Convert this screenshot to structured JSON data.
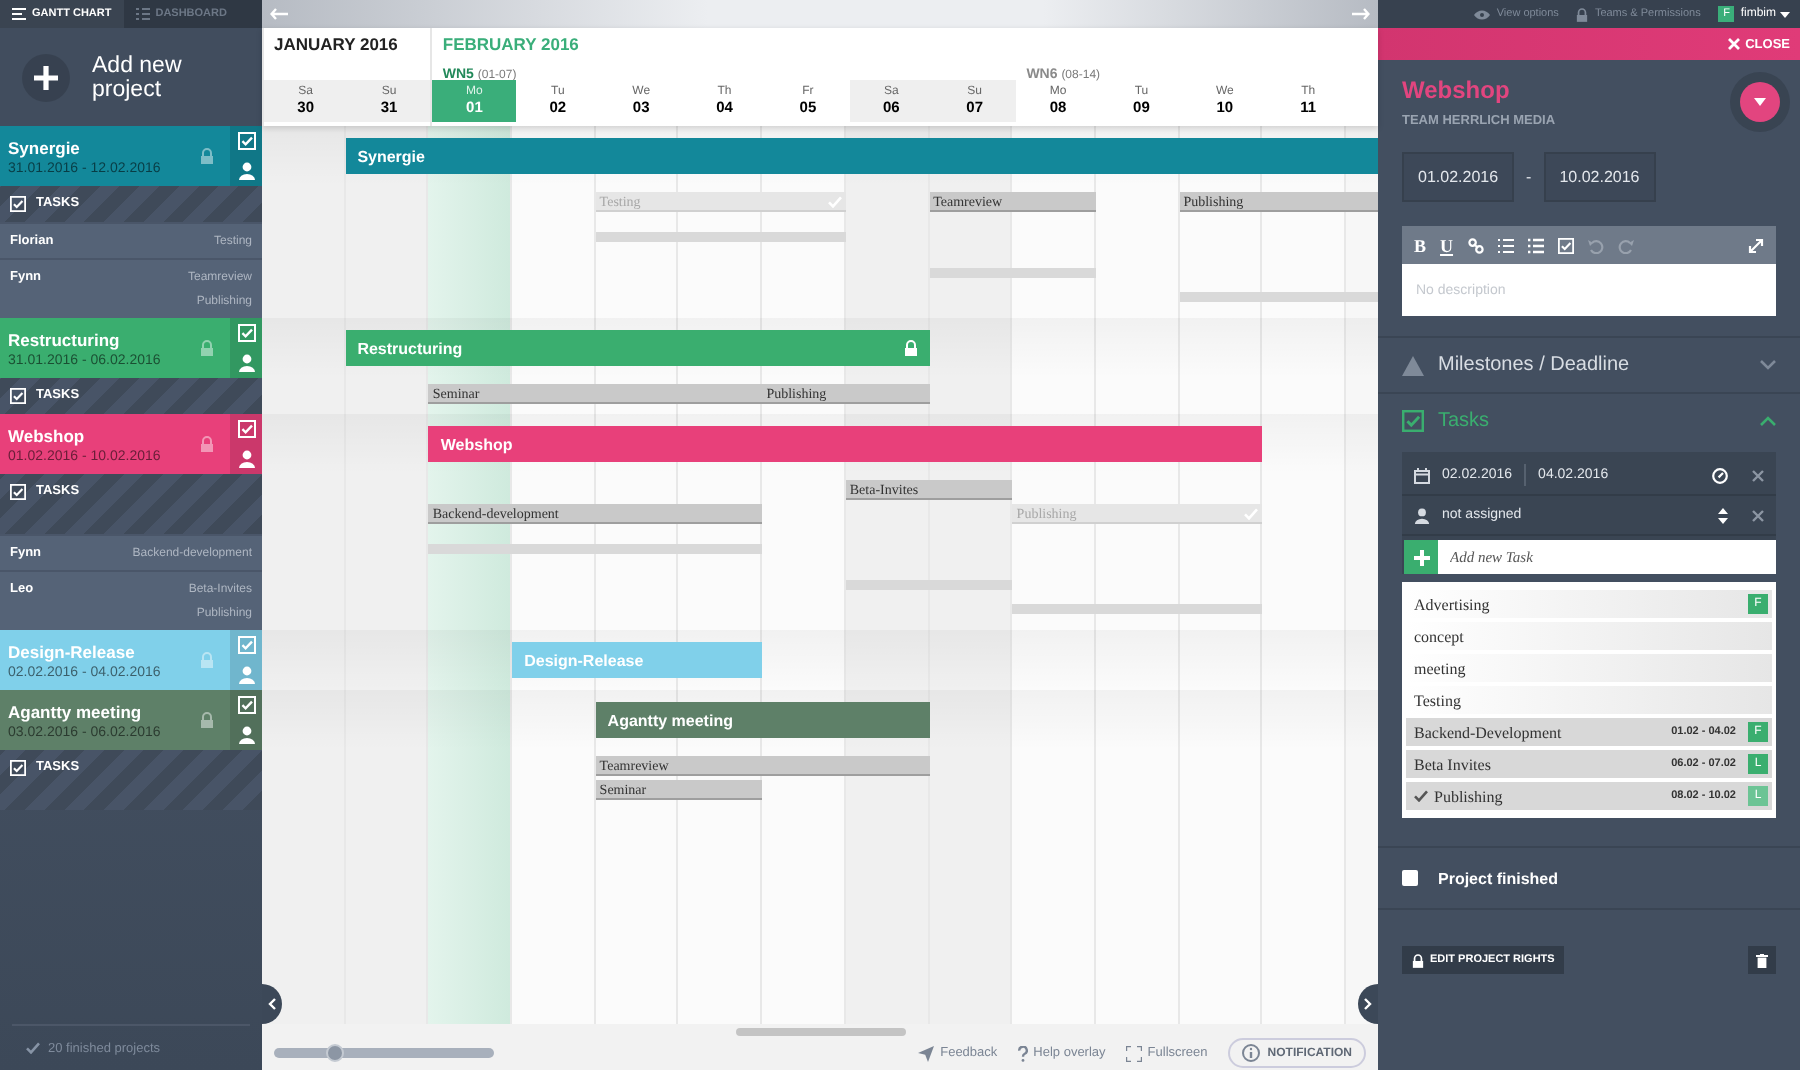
{
  "nav_tabs": [
    {
      "label": "GANTT CHART",
      "kind": "menu",
      "selected": true
    },
    {
      "label": "DASHBOARD",
      "kind": "list",
      "selected": false
    }
  ],
  "add_project": {
    "label": "Add new project"
  },
  "timeline": {
    "months": [
      {
        "label": "JANUARY 2016",
        "current": false,
        "weeks": [
          {
            "days": [
              {
                "weekday": "Sa",
                "day": "30",
                "weekend": true,
                "today": false
              },
              {
                "weekday": "Su",
                "day": "31",
                "weekend": true,
                "today": false
              }
            ]
          }
        ]
      },
      {
        "label": "FEBRUARY 2016",
        "current": true,
        "weeks": [
          {
            "label": "WN5",
            "range": "(01-07)",
            "current": true,
            "days": [
              {
                "weekday": "Mo",
                "day": "01",
                "weekend": false,
                "today": true
              },
              {
                "weekday": "Tu",
                "day": "02",
                "weekend": false,
                "today": false
              },
              {
                "weekday": "We",
                "day": "03",
                "weekend": false,
                "today": false
              },
              {
                "weekday": "Th",
                "day": "04",
                "weekend": false,
                "today": false
              },
              {
                "weekday": "Fr",
                "day": "05",
                "weekend": false,
                "today": false
              },
              {
                "weekday": "Sa",
                "day": "06",
                "weekend": true,
                "today": false
              },
              {
                "weekday": "Su",
                "day": "07",
                "weekend": true,
                "today": false
              }
            ]
          },
          {
            "label": "WN6",
            "range": "(08-14)",
            "current": false,
            "days": [
              {
                "weekday": "Mo",
                "day": "08",
                "weekend": false,
                "today": false
              },
              {
                "weekday": "Tu",
                "day": "09",
                "weekend": false,
                "today": false
              },
              {
                "weekday": "We",
                "day": "10",
                "weekend": false,
                "today": false
              },
              {
                "weekday": "Th",
                "day": "11",
                "weekend": false,
                "today": false
              }
            ]
          }
        ]
      }
    ]
  },
  "projects": [
    {
      "name": "Synergie",
      "dates": "31.01.2016 - 12.02.2016",
      "color": "#13889a",
      "locked": false,
      "bar_label": "Synergie",
      "tasks_label": "TASKS",
      "task_lanes": [
        [
          {
            "label": "Testing",
            "done": true
          },
          {
            "label": "Teamreview",
            "done": false
          },
          {
            "label": "Publishing",
            "done": false
          }
        ]
      ],
      "members": [
        {
          "name": "Florian",
          "assignments": [
            "Testing"
          ]
        },
        {
          "name": "Fynn",
          "assignments": [
            "Teamreview",
            "Publishing"
          ]
        }
      ]
    },
    {
      "name": "Restructuring",
      "dates": "31.01.2016 - 06.02.2016",
      "color": "#3aae6f",
      "locked": true,
      "bar_label": "Restructuring",
      "tasks_label": "TASKS",
      "task_lanes": [
        [
          {
            "label": "Seminar",
            "done": false
          },
          {
            "label": "Publishing",
            "done": false
          }
        ]
      ]
    },
    {
      "name": "Webshop",
      "dates": "01.02.2016 - 10.02.2016",
      "color": "#e8407a",
      "locked": false,
      "bar_label": "Webshop",
      "tasks_label": "TASKS",
      "task_lanes": [
        [
          {
            "label": "Beta-Invites",
            "done": false
          }
        ],
        [
          {
            "label": "Backend-development",
            "done": false
          },
          {
            "label": "Publishing",
            "done": true
          }
        ]
      ],
      "members": [
        {
          "name": "Fynn",
          "assignments": [
            "Backend-development"
          ]
        },
        {
          "name": "Leo",
          "assignments": [
            "Beta-Invites",
            "Publishing"
          ]
        }
      ]
    },
    {
      "name": "Design-Release",
      "dates": "02.02.2016 - 04.02.2016",
      "color": "#80d0ea",
      "locked": false,
      "bar_label": "Design-Release"
    },
    {
      "name": "Agantty meeting",
      "dates": "03.02.2016 - 06.02.2016",
      "color": "#5e8068",
      "locked": false,
      "bar_label": "Agantty meeting",
      "tasks_label": "TASKS",
      "task_lanes": [
        [
          {
            "label": "Teamreview",
            "done": false
          }
        ],
        [
          {
            "label": "Seminar",
            "done": false
          }
        ]
      ]
    }
  ],
  "footer": {
    "finished": "20 finished projects",
    "zoom": {
      "level": 0.27
    },
    "links": [
      {
        "label": "Feedback",
        "kind": "feedback"
      },
      {
        "label": "Help overlay",
        "kind": "help"
      },
      {
        "label": "Fullscreen",
        "kind": "fullscreen"
      }
    ],
    "notification": "NOTIFICATION"
  },
  "top_bar": {
    "view_options": "View options",
    "teams": "Teams & Permissions",
    "user_initial": "F",
    "user": "fimbim"
  },
  "detail": {
    "close": "CLOSE",
    "title": "Webshop",
    "team": "TEAM HERRLICH MEDIA",
    "start": "01.02.2016",
    "separator": "-",
    "end": "10.02.2016",
    "editor_buttons": [
      "B",
      "U"
    ],
    "description_placeholder": "No description",
    "milestones": {
      "label": "Milestones / Deadline",
      "expanded": false
    },
    "tasks_section": {
      "label": "Tasks",
      "expanded": true
    },
    "task_editor": {
      "start": "02.02.2016",
      "end": "04.02.2016",
      "assignee": "not assigned",
      "new_task_placeholder": "Add new Task"
    },
    "task_list": [
      {
        "label": "Advertising",
        "badge": "F",
        "done": false
      },
      {
        "label": "concept",
        "done": false
      },
      {
        "label": "meeting",
        "done": false
      },
      {
        "label": "Testing",
        "done": false
      },
      {
        "label": "Backend-Development",
        "range": "01.02 - 04.02",
        "badge": "F",
        "done": false
      },
      {
        "label": "Beta Invites",
        "range": "06.02 - 07.02",
        "badge": "L",
        "done": false
      },
      {
        "label": "Publishing",
        "range": "08.02 - 10.02",
        "badge": "L",
        "done": true
      }
    ],
    "project_finished": {
      "label": "Project finished",
      "checked": false
    },
    "edit_rights": "EDIT PROJECT RIGHTS"
  }
}
